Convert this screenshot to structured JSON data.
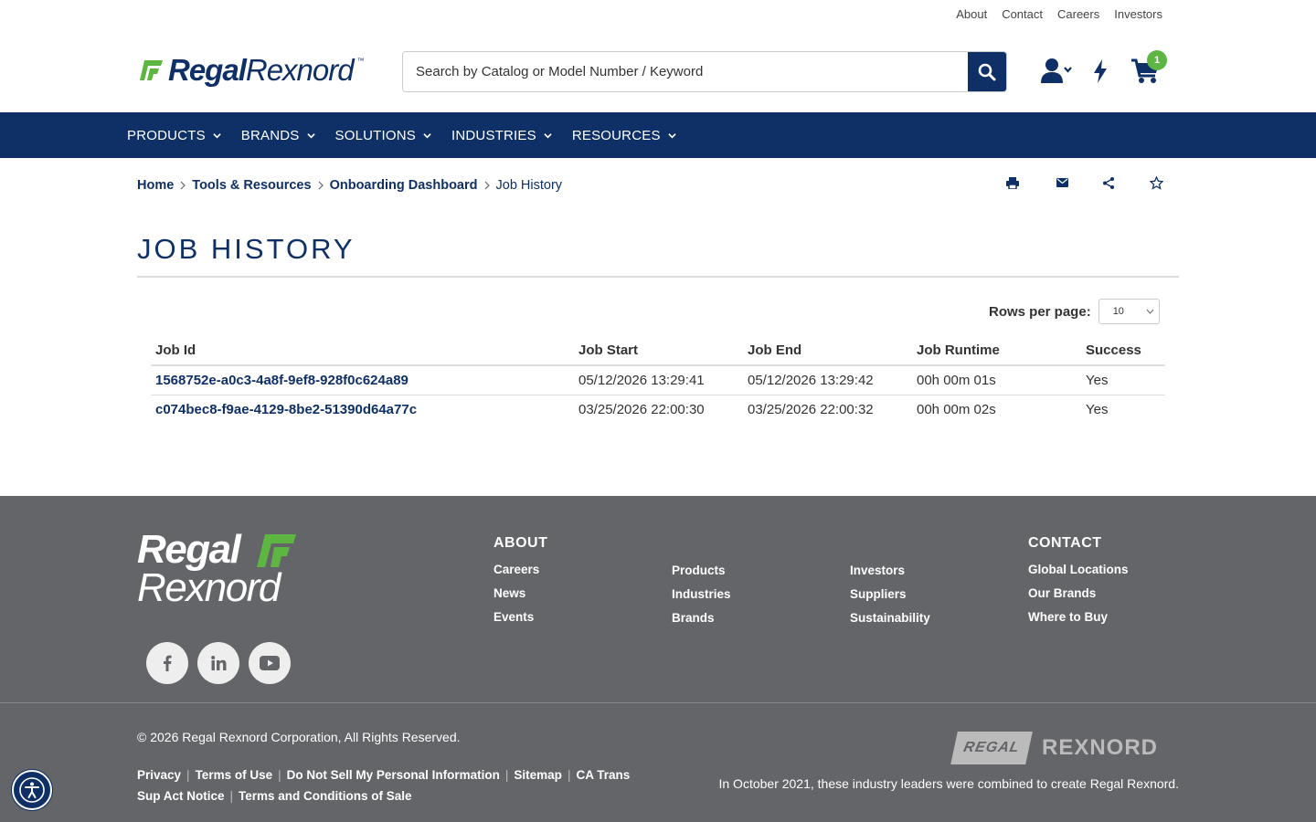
{
  "utility_nav": [
    "About",
    "Contact",
    "Careers",
    "Investors"
  ],
  "brand": {
    "name_part1": "Regal",
    "name_part2": "Rexnord",
    "trademark": "™"
  },
  "search": {
    "placeholder": "Search by Catalog or Model Number / Keyword"
  },
  "cart": {
    "count": "1"
  },
  "main_nav": [
    "PRODUCTS",
    "BRANDS",
    "SOLUTIONS",
    "INDUSTRIES",
    "RESOURCES"
  ],
  "breadcrumb": {
    "items": [
      "Home",
      "Tools & Resources",
      "Onboarding Dashboard"
    ],
    "current": "Job History"
  },
  "page": {
    "title": "JOB HISTORY"
  },
  "pagination": {
    "rows_label": "Rows per page:",
    "rows_value": "10"
  },
  "table": {
    "headers": [
      "Job Id",
      "Job Start",
      "Job End",
      "Job Runtime",
      "Success"
    ],
    "rows": [
      [
        "1568752e-a0c3-4a8f-9ef8-928f0c624a89",
        "05/12/2026 13:29:41",
        "05/12/2026 13:29:42",
        "00h 00m 01s",
        "Yes"
      ],
      [
        "c074bec8-f9ae-4129-8be2-51390d64a77c",
        "03/25/2026 22:00:30",
        "03/25/2026 22:00:32",
        "00h 00m 02s",
        "Yes"
      ]
    ]
  },
  "footer": {
    "logo_line1": "Regal",
    "logo_line2": "Rexnord",
    "about_heading": "ABOUT",
    "about_col1": [
      "Careers",
      "News",
      "Events"
    ],
    "about_col2": [
      "Products",
      "Industries",
      "Brands"
    ],
    "about_col3": [
      "Investors",
      "Suppliers",
      "Sustainability"
    ],
    "contact_heading": "CONTACT",
    "contact_items": [
      "Global Locations",
      "Our Brands",
      "Where to Buy"
    ],
    "copyright": "© 2026 Regal Rexnord Corporation, All Rights Reserved.",
    "legal_links": [
      "Privacy",
      "Terms of Use",
      "Do Not Sell My Personal Information",
      "Sitemap",
      "CA Trans Sup Act Notice",
      "Terms and Conditions of Sale"
    ],
    "brand_regal": "REGAL",
    "brand_rexnord": "REXNORD",
    "combined_note": "In October 2021, these industry leaders were combined to create Regal Rexnord."
  },
  "colors": {
    "primary": "#0f3067",
    "accent_green": "#5eb642",
    "footer_bg": "#646569"
  }
}
